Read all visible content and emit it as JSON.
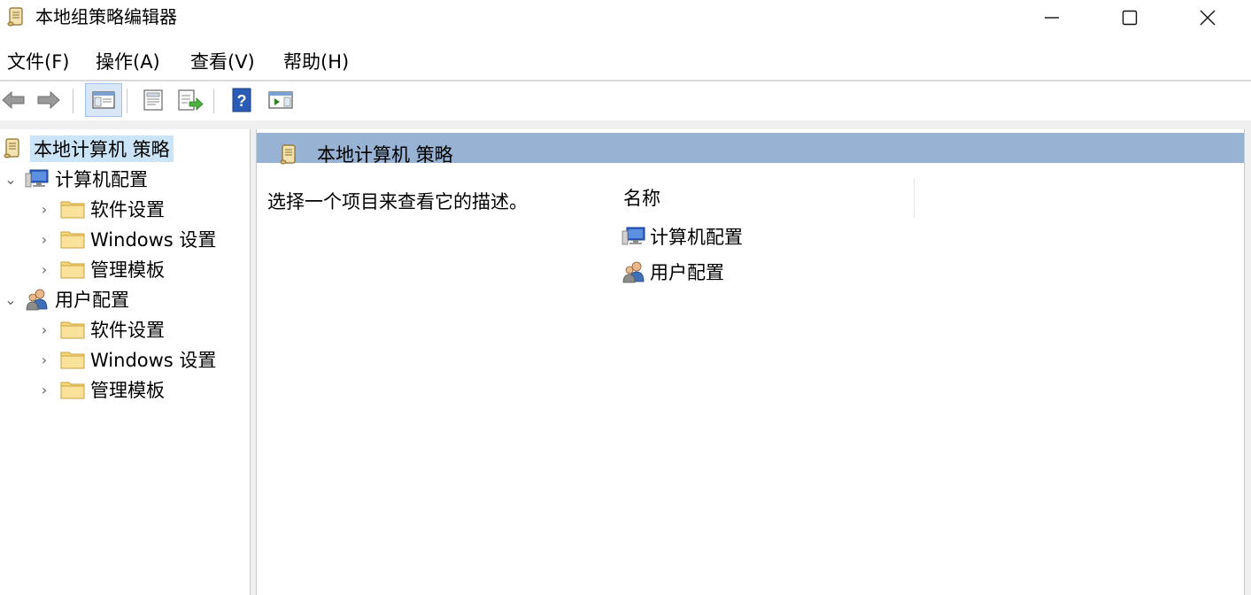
{
  "window": {
    "title": "本地组策略编辑器",
    "icon": "policy-scroll-icon"
  },
  "menu": [
    {
      "label": "文件(F)"
    },
    {
      "label": "操作(A)"
    },
    {
      "label": "查看(V)"
    },
    {
      "label": "帮助(H)"
    }
  ],
  "toolbar": [
    {
      "name": "back-button",
      "icon": "arrow-left-icon"
    },
    {
      "name": "forward-button",
      "icon": "arrow-right-icon"
    },
    {
      "name": "show-hide-tree-button",
      "icon": "console-tree-icon",
      "active": true
    },
    {
      "name": "properties-button",
      "icon": "properties-icon"
    },
    {
      "name": "export-list-button",
      "icon": "export-list-icon"
    },
    {
      "name": "help-button",
      "icon": "help-icon"
    },
    {
      "name": "show-hide-action-pane-button",
      "icon": "action-pane-icon"
    }
  ],
  "tree": [
    {
      "label": "本地计算机 策略",
      "icon": "policy-scroll-icon",
      "selected": true,
      "chevron": ""
    },
    {
      "label": "计算机配置",
      "icon": "computer-icon",
      "chevron": "⌄"
    },
    {
      "label": "软件设置",
      "icon": "folder-icon",
      "chevron": "›"
    },
    {
      "label": "Windows 设置",
      "icon": "folder-icon",
      "chevron": "›"
    },
    {
      "label": "管理模板",
      "icon": "folder-icon",
      "chevron": "›"
    },
    {
      "label": "用户配置",
      "icon": "users-icon",
      "chevron": "⌄"
    },
    {
      "label": "软件设置",
      "icon": "folder-icon",
      "chevron": "›"
    },
    {
      "label": "Windows 设置",
      "icon": "folder-icon",
      "chevron": "›"
    },
    {
      "label": "管理模板",
      "icon": "folder-icon",
      "chevron": "›"
    }
  ],
  "right_panel": {
    "header_title": "本地计算机 策略",
    "description": "选择一个项目来查看它的描述。",
    "column_header": "名称",
    "items": [
      {
        "label": "计算机配置",
        "icon": "computer-icon"
      },
      {
        "label": "用户配置",
        "icon": "users-icon"
      }
    ]
  }
}
